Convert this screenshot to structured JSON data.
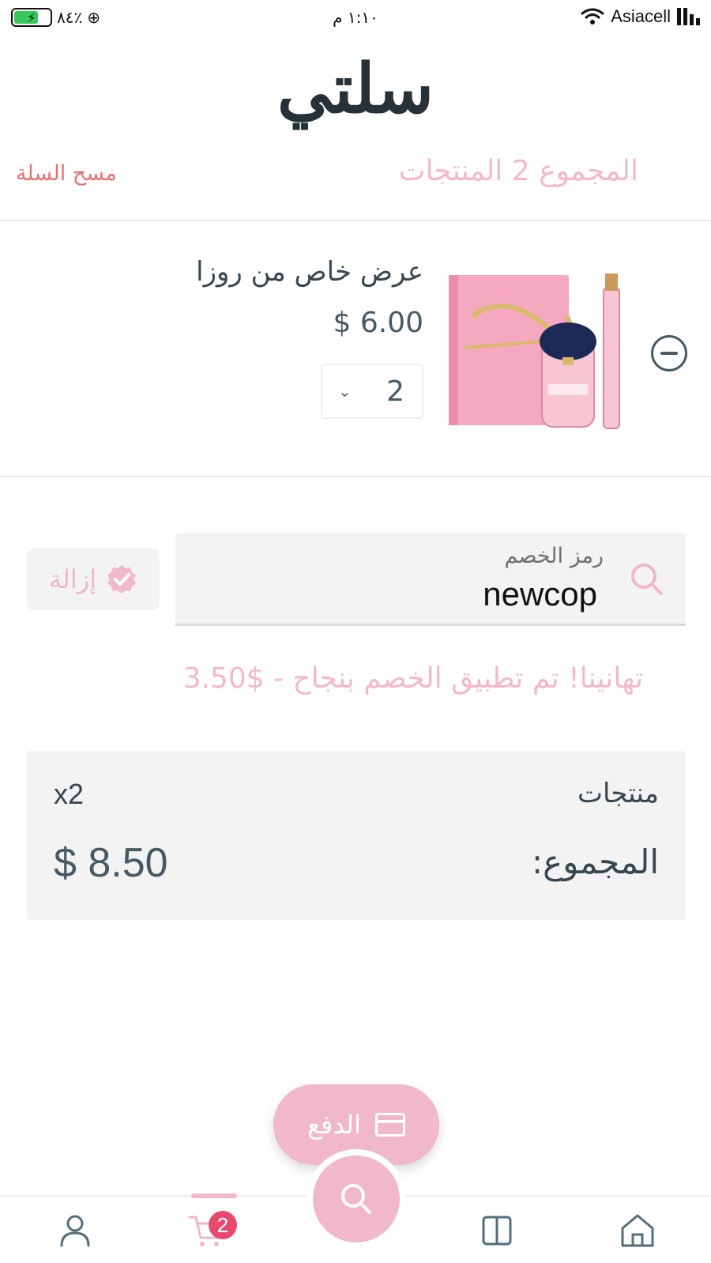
{
  "status_bar": {
    "battery": "٨٤٪",
    "time": "١:١٠ م",
    "carrier": "Asiacell"
  },
  "header": {
    "title": "سلتي",
    "total_count": "المجموع 2 المنتجات",
    "clear_cart": "مسح السلة"
  },
  "cart_items": [
    {
      "name": "عرض خاص من روزا",
      "price": "$ 6.00",
      "quantity": "2",
      "image": "perfume-gift-set"
    }
  ],
  "coupon": {
    "label": "رمز الخصم",
    "value": "newcop",
    "remove_label": "إزالة",
    "success_message": "تهانينا! تم تطبيق الخصم بنجاح - $3.50"
  },
  "summary": {
    "products_label": "منتجات",
    "products_count": "x2",
    "total_label": "المجموع:",
    "total_value": "$ 8.50"
  },
  "checkout": {
    "pay_label": "الدفع"
  },
  "bottom_nav": {
    "cart_badge": "2",
    "items": [
      "home-icon",
      "catalog-icon",
      "search-icon",
      "cart-icon",
      "profile-icon"
    ]
  },
  "colors": {
    "accent_pink": "#f0b8c8",
    "badge_red": "#e84a6f",
    "clear_red": "#e57373",
    "text_dark": "#37474f"
  }
}
